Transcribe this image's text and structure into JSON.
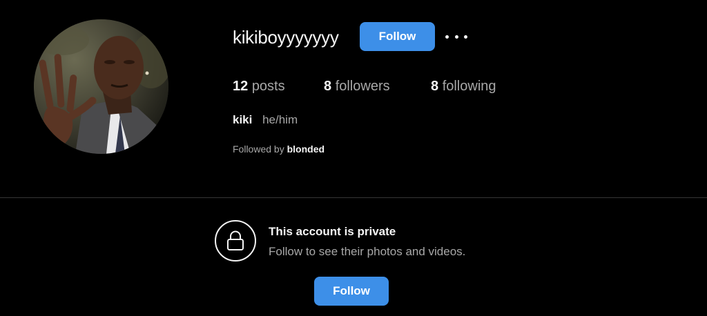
{
  "profile": {
    "username": "kikiboyyyyyyy",
    "follow_label": "Follow",
    "more_icon": "more-options-icon",
    "avatar": "profile-photo",
    "stats": {
      "posts_count": "12",
      "posts_label": "posts",
      "followers_count": "8",
      "followers_label": "followers",
      "following_count": "8",
      "following_label": "following"
    },
    "display_name": "kiki",
    "pronouns": "he/him",
    "followed_by_prefix": "Followed by",
    "followed_by_user": "blonded"
  },
  "private": {
    "icon": "lock-icon",
    "title": "This account is private",
    "subtitle": "Follow to see their photos and videos.",
    "follow_label": "Follow"
  },
  "colors": {
    "background": "#000000",
    "accent": "#3d8fe8",
    "text_primary": "#f5f5f5",
    "text_secondary": "#a8a8a8",
    "divider": "#363636"
  }
}
